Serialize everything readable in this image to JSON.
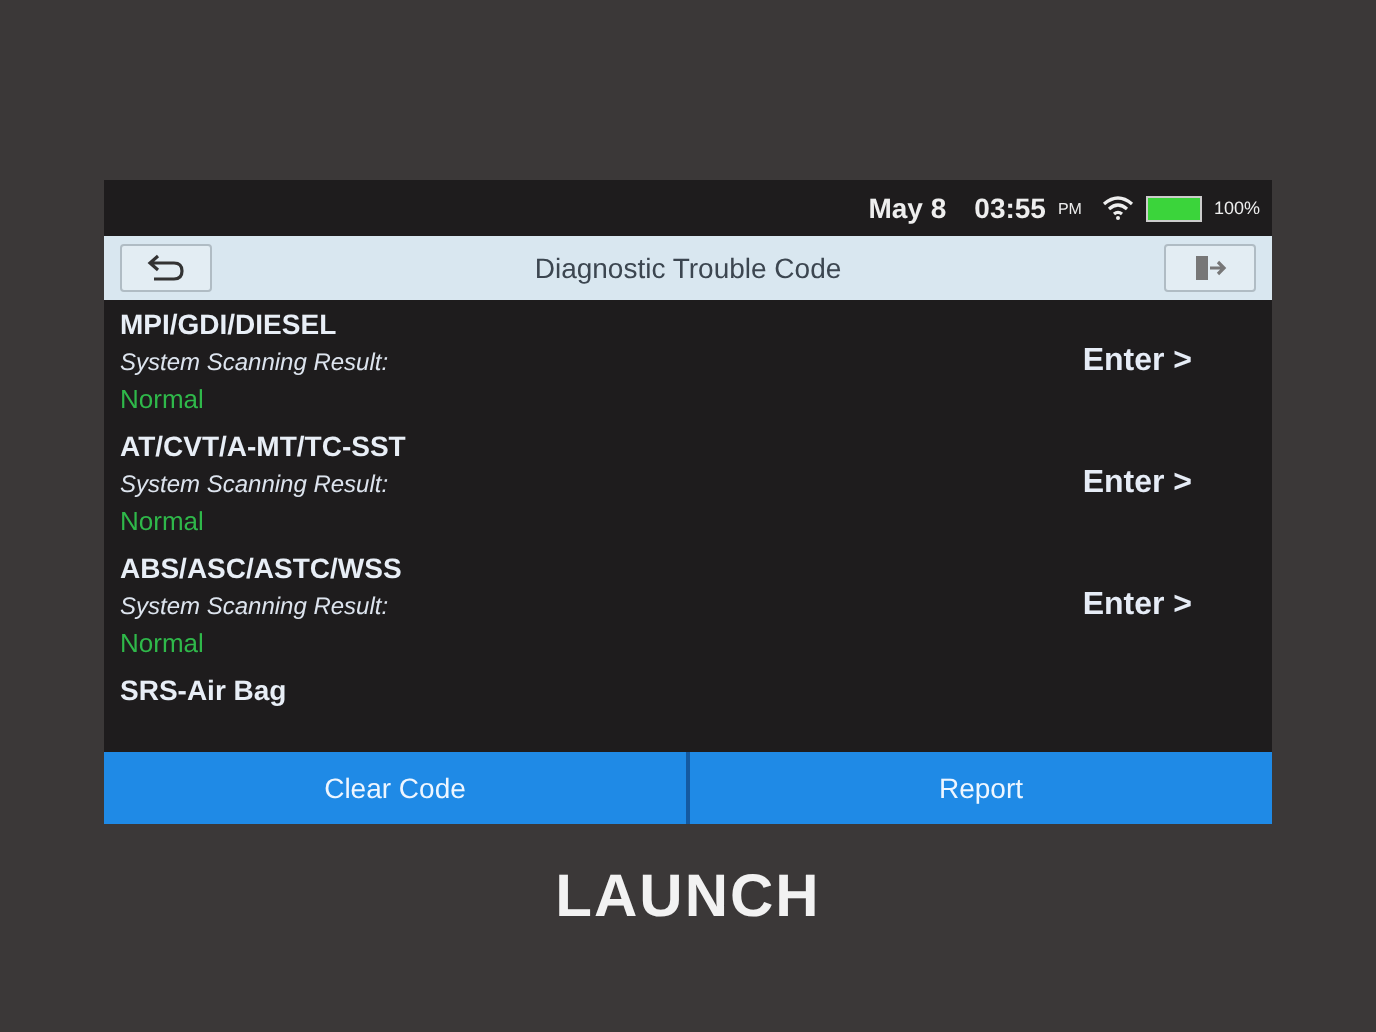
{
  "status_bar": {
    "date": "May 8",
    "time": "03:55",
    "meridiem": "PM",
    "battery": {
      "level": 1.0,
      "reading": "100%"
    }
  },
  "title_bar": {
    "title": "Diagnostic Trouble Code"
  },
  "systems": [
    {
      "name": "MPI/GDI/DIESEL",
      "label": "System Scanning Result:",
      "result": "Normal",
      "action": "Enter >"
    },
    {
      "name": "AT/CVT/A-MT/TC-SST",
      "label": "System Scanning Result:",
      "result": "Normal",
      "action": "Enter >"
    },
    {
      "name": "ABS/ASC/ASTC/WSS",
      "label": "System Scanning Result:",
      "result": "Normal",
      "action": "Enter >"
    },
    {
      "name": "SRS-Air Bag"
    }
  ],
  "buttons": [
    "Clear Code",
    "Report"
  ],
  "device_logo": "LAUNCH"
}
